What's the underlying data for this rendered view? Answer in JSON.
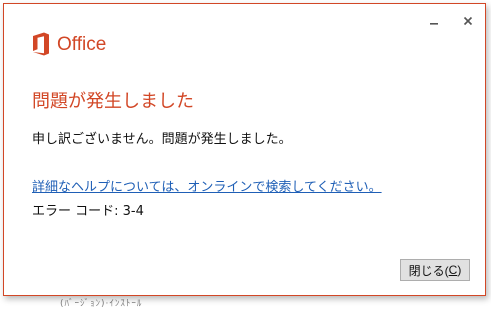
{
  "brand": {
    "logo_text": "Office",
    "accent_color": "#d24726",
    "logo_icon": "office-logo-icon"
  },
  "titlebar": {
    "minimize_icon": "minimize-icon",
    "close_icon": "close-icon"
  },
  "dialog": {
    "heading": "問題が発生しました",
    "message": "申し訳ございません。問題が発生しました。",
    "help_link": "詳細なヘルプについては、オンラインで検索してください。",
    "error_code": "エラー コード: 3-4"
  },
  "buttons": {
    "close_label": "閉じる(",
    "close_accel": "C",
    "close_label_end": ")"
  },
  "background_text": "(ﾊﾞｰｼﾞｮﾝ)·ｲﾝｽﾄｰﾙ"
}
